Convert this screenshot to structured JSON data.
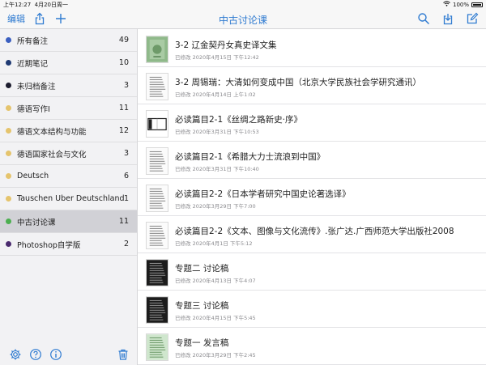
{
  "status_bar": {
    "time": "上午12:27",
    "date": "4月20日周一",
    "battery": "100%"
  },
  "nav": {
    "edit_label": "编辑",
    "title": "中古讨论课"
  },
  "colors": {
    "accent": "#2f7bd1"
  },
  "sidebar": {
    "items": [
      {
        "label": "所有备注",
        "count": "49",
        "color": "#3b5fc0"
      },
      {
        "label": "近期笔记",
        "count": "10",
        "color": "#1f3a73"
      },
      {
        "label": "未归档备注",
        "count": "3",
        "color": "#1c1c2e"
      },
      {
        "label": "德语写作I",
        "count": "11",
        "color": "#e5c46d"
      },
      {
        "label": "德语文本结构与功能",
        "count": "12",
        "color": "#e5c46d"
      },
      {
        "label": "德语国家社会与文化",
        "count": "3",
        "color": "#e5c46d"
      },
      {
        "label": "Deutsch",
        "count": "6",
        "color": "#e5c46d"
      },
      {
        "label": "Tauschen Über Deutschland",
        "count": "1",
        "color": "#e5c46d"
      },
      {
        "label": "中古讨论课",
        "count": "11",
        "color": "#4caf50"
      },
      {
        "label": "Photoshop自学版",
        "count": "2",
        "color": "#4a2a6e"
      }
    ]
  },
  "notes": [
    {
      "title": "3-2 辽金契丹女真史译文集",
      "date": "已修改 2020年4月15日 下午12:42",
      "thumb": "green-cover"
    },
    {
      "title": "3-2 周锡瑞：大清如何变成中国（北京大学民族社会学研究通讯）",
      "date": "已修改 2020年4月14日 上午1:02",
      "thumb": "text-page"
    },
    {
      "title": "必读篇目2-1《丝绸之路新史·序》",
      "date": "已修改 2020年3月31日 下午10:53",
      "thumb": "book-open"
    },
    {
      "title": "必读篇目2-1《希腊大力士流浪到中国》",
      "date": "已修改 2020年3月31日 下午10:40",
      "thumb": "text-page"
    },
    {
      "title": "必读篇目2-2《日本学者研究中国史论著选译》",
      "date": "已修改 2020年3月29日 下午7:00",
      "thumb": "text-page"
    },
    {
      "title": "必读篇目2-2《文本、图像与文化流传》.张广达.广西师范大学出版社2008",
      "date": "已修改 2020年4月1日 下午5:12",
      "thumb": "text-page"
    },
    {
      "title": "专题二 讨论稿",
      "date": "已修改 2020年4月13日 下午4:07",
      "thumb": "dark-page"
    },
    {
      "title": "专题三 讨论稿",
      "date": "已修改 2020年4月15日 下午5:45",
      "thumb": "dark-page"
    },
    {
      "title": "专题一 发言稿",
      "date": "已修改 2020年3月29日 下午2:45",
      "thumb": "green-page"
    }
  ]
}
